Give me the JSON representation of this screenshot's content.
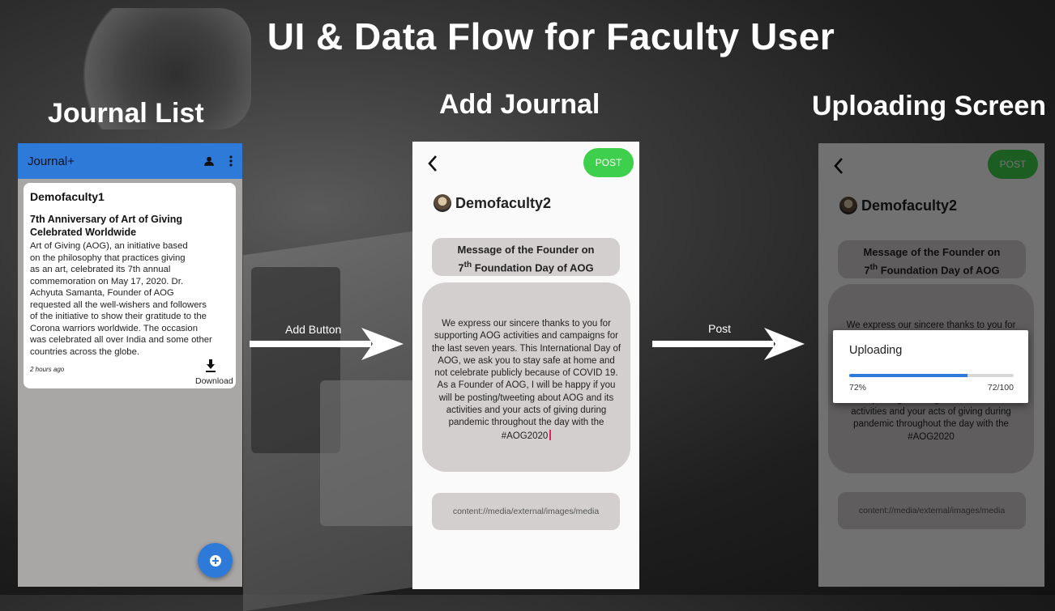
{
  "page_title": "UI & Data Flow for Faculty User",
  "sections": {
    "journal_list": "Journal List",
    "add_journal": "Add Journal",
    "uploading": "Uploading Screen"
  },
  "arrows": {
    "first_label": "Add Button",
    "second_label": "Post"
  },
  "journal_list": {
    "app_title": "Journal+",
    "icons": [
      "person-icon",
      "more-vert-icon",
      "download-icon",
      "add-icon"
    ],
    "card": {
      "author": "Demofaculty1",
      "heading_line1": "7th Anniversary of Art of Giving",
      "heading_line2": "Celebrated Worldwide",
      "body": [
        "Art of Giving (AOG), an initiative based",
        "on the philosophy that practices giving",
        "as an art, celebrated its 7th annual",
        "commemoration on May 17, 2020. Dr.",
        "Achyuta Samanta, Founder of AOG",
        "requested all the well-wishers and followers",
        "of the initiative to show their gratitude to the",
        "Corona warriors worldwide. The occasion",
        "was celebrated all over India and some other",
        "countries across the globe."
      ],
      "time": "2 hours ago",
      "download_label": "Download"
    }
  },
  "add_journal": {
    "post_label": "POST",
    "username": "Demofaculty2",
    "title_line1": "Message of the Founder on",
    "title_ordinal": "7",
    "title_sup": "th",
    "title_rest": " Foundation Day of AOG",
    "message_lines": [
      "We express our sincere thanks to you for",
      "supporting AOG activities and campaigns for",
      "the last seven years. This International Day of",
      "AOG, we ask you to stay safe at home and",
      "not celebrate publicly because of COVID 19.",
      "As a Founder of AOG, I will be happy if you",
      "will be posting/tweeting about AOG and its",
      "activities and your acts of giving during",
      "pandemic throughout the day with the",
      "#AOG2020"
    ],
    "media_path": "content://media/external/images/media"
  },
  "uploading": {
    "dialog_title": "Uploading",
    "progress": 0.72,
    "percent_label": "72%",
    "count_label": "72/100"
  },
  "colors": {
    "appbar": "#2e7ad9",
    "post_button": "#3ecf4c",
    "field_bg": "#d3cfcf"
  }
}
